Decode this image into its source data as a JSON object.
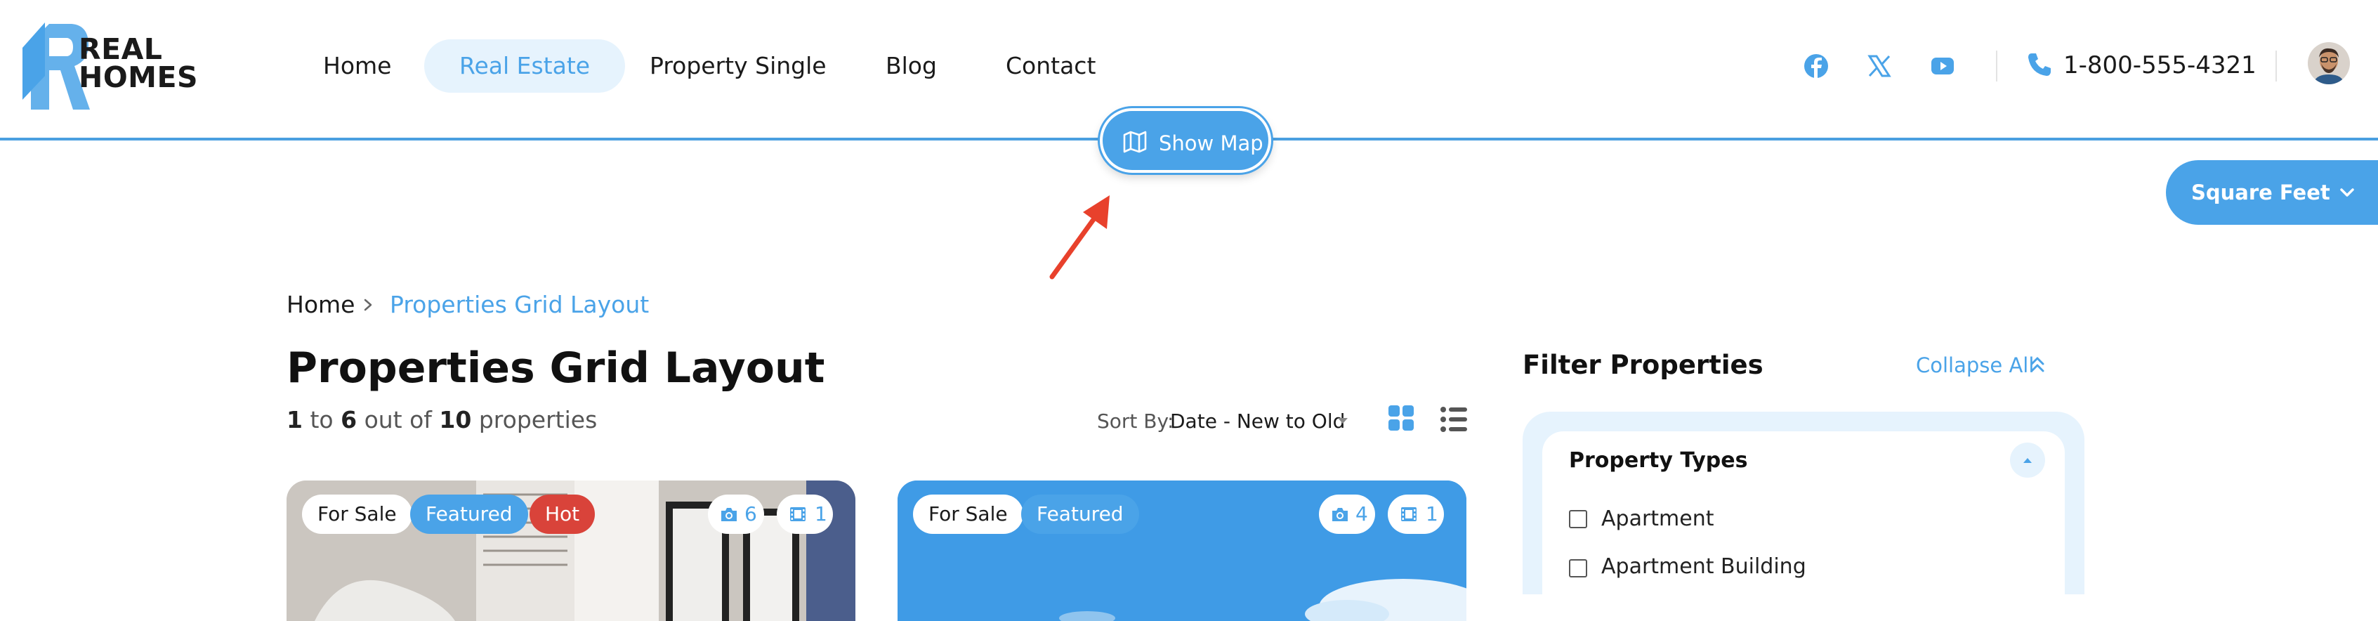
{
  "logo": {
    "line1": "REAL",
    "line2": "HOMES"
  },
  "nav": {
    "items": [
      {
        "label": "Home",
        "active": false
      },
      {
        "label": "Real Estate",
        "active": true
      },
      {
        "label": "Property Single",
        "active": false
      },
      {
        "label": "Blog",
        "active": false
      },
      {
        "label": "Contact",
        "active": false
      }
    ]
  },
  "header": {
    "social": [
      "facebook-icon",
      "x-twitter-icon",
      "youtube-icon"
    ],
    "phone": "1-800-555-4321"
  },
  "map_button": {
    "label": "Show Map"
  },
  "area_unit": {
    "label": "Square Feet"
  },
  "breadcrumb": {
    "home": "Home",
    "current": "Properties Grid Layout"
  },
  "page": {
    "title": "Properties Grid Layout",
    "count_from": "1",
    "count_to_word": "to",
    "count_to": "6",
    "count_of_word": "out of",
    "count_total": "10",
    "count_suffix": "properties"
  },
  "sort": {
    "label": "Sort By:",
    "value": "Date - New to Old"
  },
  "cards": [
    {
      "tags": [
        "For Sale",
        "Featured",
        "Hot"
      ],
      "photos": "6",
      "videos": "1"
    },
    {
      "tags": [
        "For Sale",
        "Featured"
      ],
      "photos": "4",
      "videos": "1"
    }
  ],
  "sidebar": {
    "title": "Filter Properties",
    "collapse_all": "Collapse All",
    "section_title": "Property Types",
    "options": [
      "Apartment",
      "Apartment Building"
    ]
  },
  "colors": {
    "accent": "#4aa3e8",
    "accent_light": "#e6f3fd",
    "hot": "#d9433a",
    "arrow": "#e8412c"
  }
}
